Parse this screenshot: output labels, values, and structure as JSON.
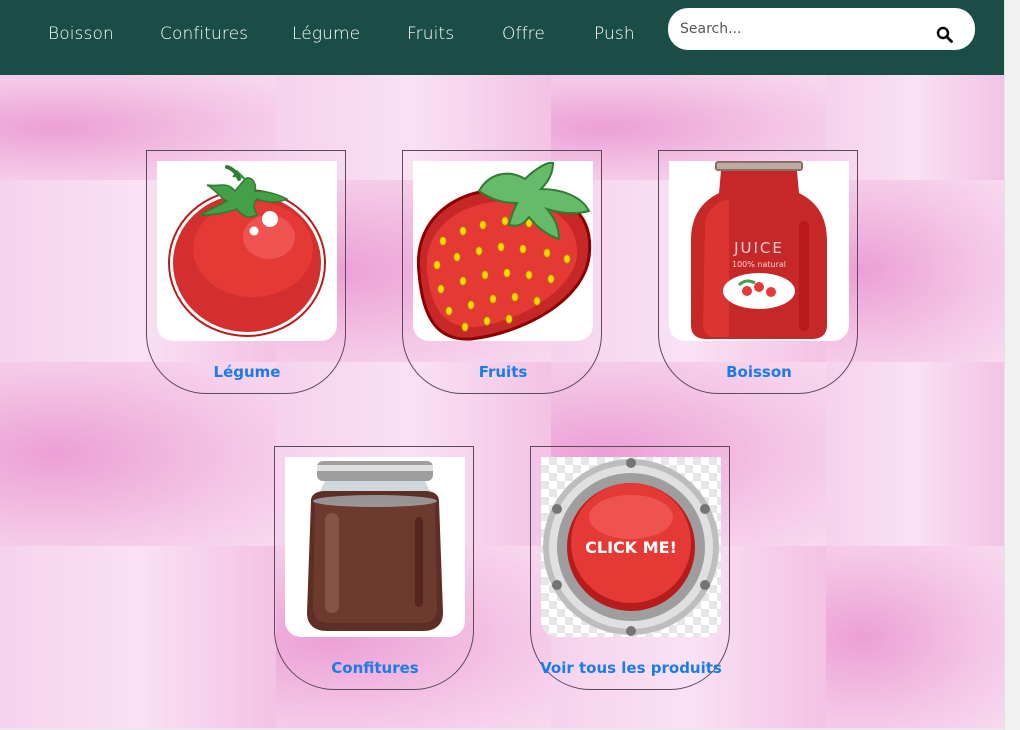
{
  "nav": {
    "items": [
      "Boisson",
      "Confitures",
      "Légume",
      "Fruits",
      "Offre",
      "Push"
    ],
    "search_placeholder": "Search..."
  },
  "categories": [
    {
      "label": "Légume",
      "image": "tomato"
    },
    {
      "label": "Fruits",
      "image": "strawberry"
    },
    {
      "label": "Boisson",
      "image": "juice-bottle"
    },
    {
      "label": "Confitures",
      "image": "jam-jar"
    },
    {
      "label": "Voir tous les produits",
      "image": "click-me-button",
      "image_text": "CLICK ME!"
    }
  ],
  "juice_bottle": {
    "label_line1": "JUICE",
    "label_line2": "100% natural"
  },
  "colors": {
    "navbar": "#1b4d47",
    "background": "#f3c6e6",
    "card_label": "#1a7de6"
  }
}
